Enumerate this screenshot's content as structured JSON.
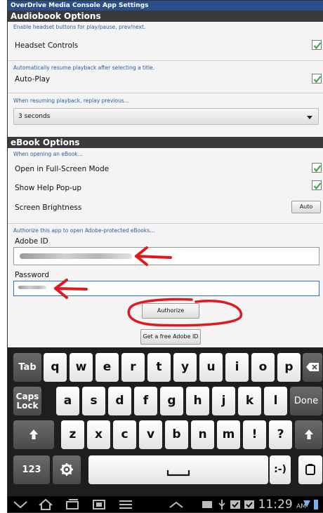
{
  "app_title": "OverDrive Media Console App Settings",
  "audiobook": {
    "section_title": "Audiobook Options",
    "headset_hint": "Enable headset buttons for play/pause, prev/next.",
    "headset_label": "Headset Controls",
    "headset_checked": true,
    "autoplay_hint": "Automatically resume playback after selecting a title.",
    "autoplay_label": "Auto-Play",
    "autoplay_checked": true,
    "replay_hint": "When resuming playback, replay previous...",
    "replay_value": "3 seconds"
  },
  "ebook": {
    "section_title": "eBook Options",
    "opening_hint": "When opening an eBook...",
    "fullscreen_label": "Open in Full-Screen Mode",
    "fullscreen_checked": true,
    "helppopup_label": "Show Help Pop-up",
    "helppopup_checked": true,
    "brightness_label": "Screen Brightness",
    "brightness_button": "Auto",
    "authorize_hint": "Authorize this app to open Adobe-protected eBooks...",
    "adobe_id_label": "Adobe ID",
    "password_label": "Password",
    "authorize_button": "Authorize",
    "get_id_button": "Get a free Adobe ID"
  },
  "keyboard": {
    "row1": [
      "q",
      "w",
      "e",
      "r",
      "t",
      "y",
      "u",
      "i",
      "o",
      "p"
    ],
    "row2": [
      "a",
      "s",
      "d",
      "f",
      "g",
      "h",
      "j",
      "k",
      "l"
    ],
    "row3": [
      "z",
      "x",
      "c",
      "v",
      "b",
      "n",
      "m",
      "!",
      "?"
    ],
    "tab": "Tab",
    "caps_top": "Caps",
    "caps_bottom": "Lock",
    "done": "Done",
    "num": "123",
    "smiley": ":-)"
  },
  "status_bar": {
    "time": "11:29",
    "ampm": "AM"
  },
  "colors": {
    "title_bar": "#2b4f8a",
    "section_header": "#3a3a3a",
    "check_mark": "#3fa64a",
    "annotation_red": "#e0191c",
    "focus_blue": "#2b6fd0"
  }
}
